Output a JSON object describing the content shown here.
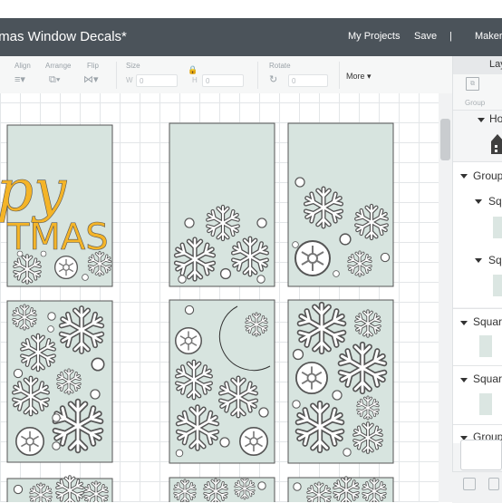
{
  "app": {
    "title": "tmas Window Decals*",
    "nav": {
      "projects": "My Projects",
      "save": "Save",
      "sep": "|",
      "maker": "Maker"
    }
  },
  "toolbar": {
    "align": {
      "label": "Align",
      "icon": "≡▾"
    },
    "arrange": {
      "label": "Arrange",
      "icon": "⧉▾"
    },
    "flip": {
      "label": "Flip",
      "icon": "⋈▾"
    },
    "size": {
      "label": "Size",
      "w_label": "W",
      "h_label": "H",
      "w_value": "0",
      "h_value": "0"
    },
    "lock_icon": "🔒",
    "rotate": {
      "label": "Rotate",
      "icon": "↻",
      "value": "0"
    },
    "more": "More ▾"
  },
  "layers_panel": {
    "tab": "Lay",
    "group_button": "Group",
    "rows": [
      {
        "label": "Ho",
        "icon": "house-icon"
      },
      {
        "label": "Group"
      },
      {
        "label": "Sq"
      },
      {
        "label": "Sq"
      },
      {
        "label": "Squar"
      },
      {
        "label": "Squar"
      },
      {
        "label": "Group"
      }
    ]
  },
  "design": {
    "panel_fill": "#d7e4df",
    "accent_yellow": "#f4b428",
    "moon_color": "#4a4a4a",
    "text_line1": "py",
    "text_line2": "TMAS"
  }
}
